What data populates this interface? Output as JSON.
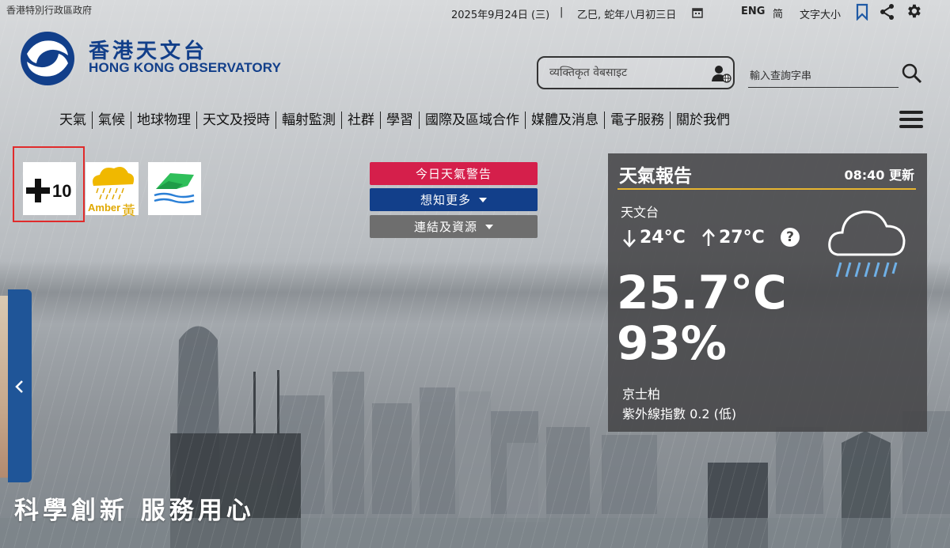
{
  "header": {
    "gov_name": "香港特別行政區政府",
    "date": "2025年9月24日 (三)",
    "separator": "|",
    "lunar_date": "乙巳, 蛇年八月初三日",
    "lang_eng": "ENG",
    "lang_sc": "简",
    "font_size": "文字大小"
  },
  "logo": {
    "zh": "香港天文台",
    "en": "HONG KONG OBSERVATORY"
  },
  "search": {
    "translate_placeholder": "व्यक्तिकृत वेबसाइट",
    "dict_placeholder": "輸入查詢字串"
  },
  "nav": {
    "items": [
      "天氣",
      "氣候",
      "地球物理",
      "天文及授時",
      "輻射監測",
      "社群",
      "學習",
      "國際及區域合作",
      "媒體及消息",
      "電子服務",
      "關於我們"
    ]
  },
  "warnings": {
    "signal_label": "10",
    "amber_label": "Amber",
    "amber_zh": "黃"
  },
  "buttons": {
    "warnings": "今日天氣警告",
    "more": "想知更多",
    "links": "連結及資源"
  },
  "colors": {
    "warnings_btn": "#d51f4b",
    "more_btn": "#123f8a",
    "links_btn": "#6e6e6e",
    "accent_rule": "#e7b530",
    "brand": "#123f8a"
  },
  "weather": {
    "title": "天氣報告",
    "updated": "08:40 更新",
    "station": "天文台",
    "min_temp": "24°C",
    "max_temp": "27°C",
    "help": "?",
    "temperature": "25.7°C",
    "humidity": "93%",
    "uv_station": "京士柏",
    "uv_index": "紫外線指數 0.2 (低)"
  },
  "slogan": "科學創新 服務用心",
  "icons": [
    "calendar-icon",
    "bookmark-icon",
    "share-icon",
    "gear-icon",
    "user-globe-icon",
    "search-icon",
    "menu-icon",
    "rain-cloud-icon",
    "arrow-down-icon",
    "arrow-up-icon",
    "chevron-left-icon"
  ]
}
